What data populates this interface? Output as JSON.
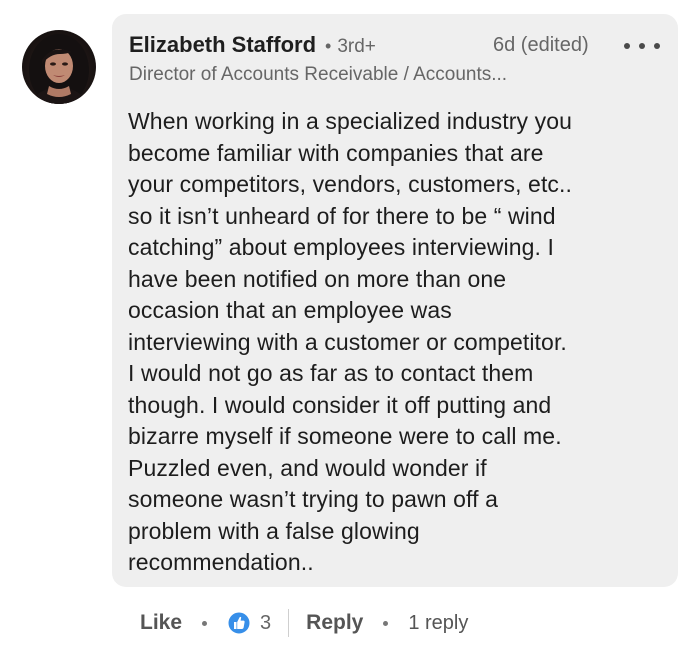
{
  "comment": {
    "author": {
      "name": "Elizabeth Stafford",
      "degree": "3rd+",
      "headline": "Director of Accounts Receivable / Accounts..."
    },
    "meta": {
      "separator": "•",
      "time": "6d (edited)",
      "more_icon": "more-horizontal-icon"
    },
    "text": "When working in a specialized industry you\nbecome familiar with companies that are\nyour competitors, vendors, customers, etc..\nso it isn’t unheard of for there to be “ wind\ncatching” about employees interviewing.  I\nhave been notified on more than one\noccasion that an employee was\ninterviewing with a customer or competitor.\nI would not go as far as to contact them\nthough.  I would consider it off putting and\nbizarre myself if someone were to call me.\nPuzzled even, and would wonder if\nsomeone wasn’t trying to pawn off a\nproblem with a false glowing\nrecommendation.."
  },
  "actions": {
    "like_label": "Like",
    "reaction_icon": "thumbs-up-icon",
    "reaction_count": "3",
    "reply_label": "Reply",
    "reply_count": "1 reply"
  },
  "colors": {
    "bubble_background": "#efefef",
    "reaction_blue": "#378fe9"
  }
}
